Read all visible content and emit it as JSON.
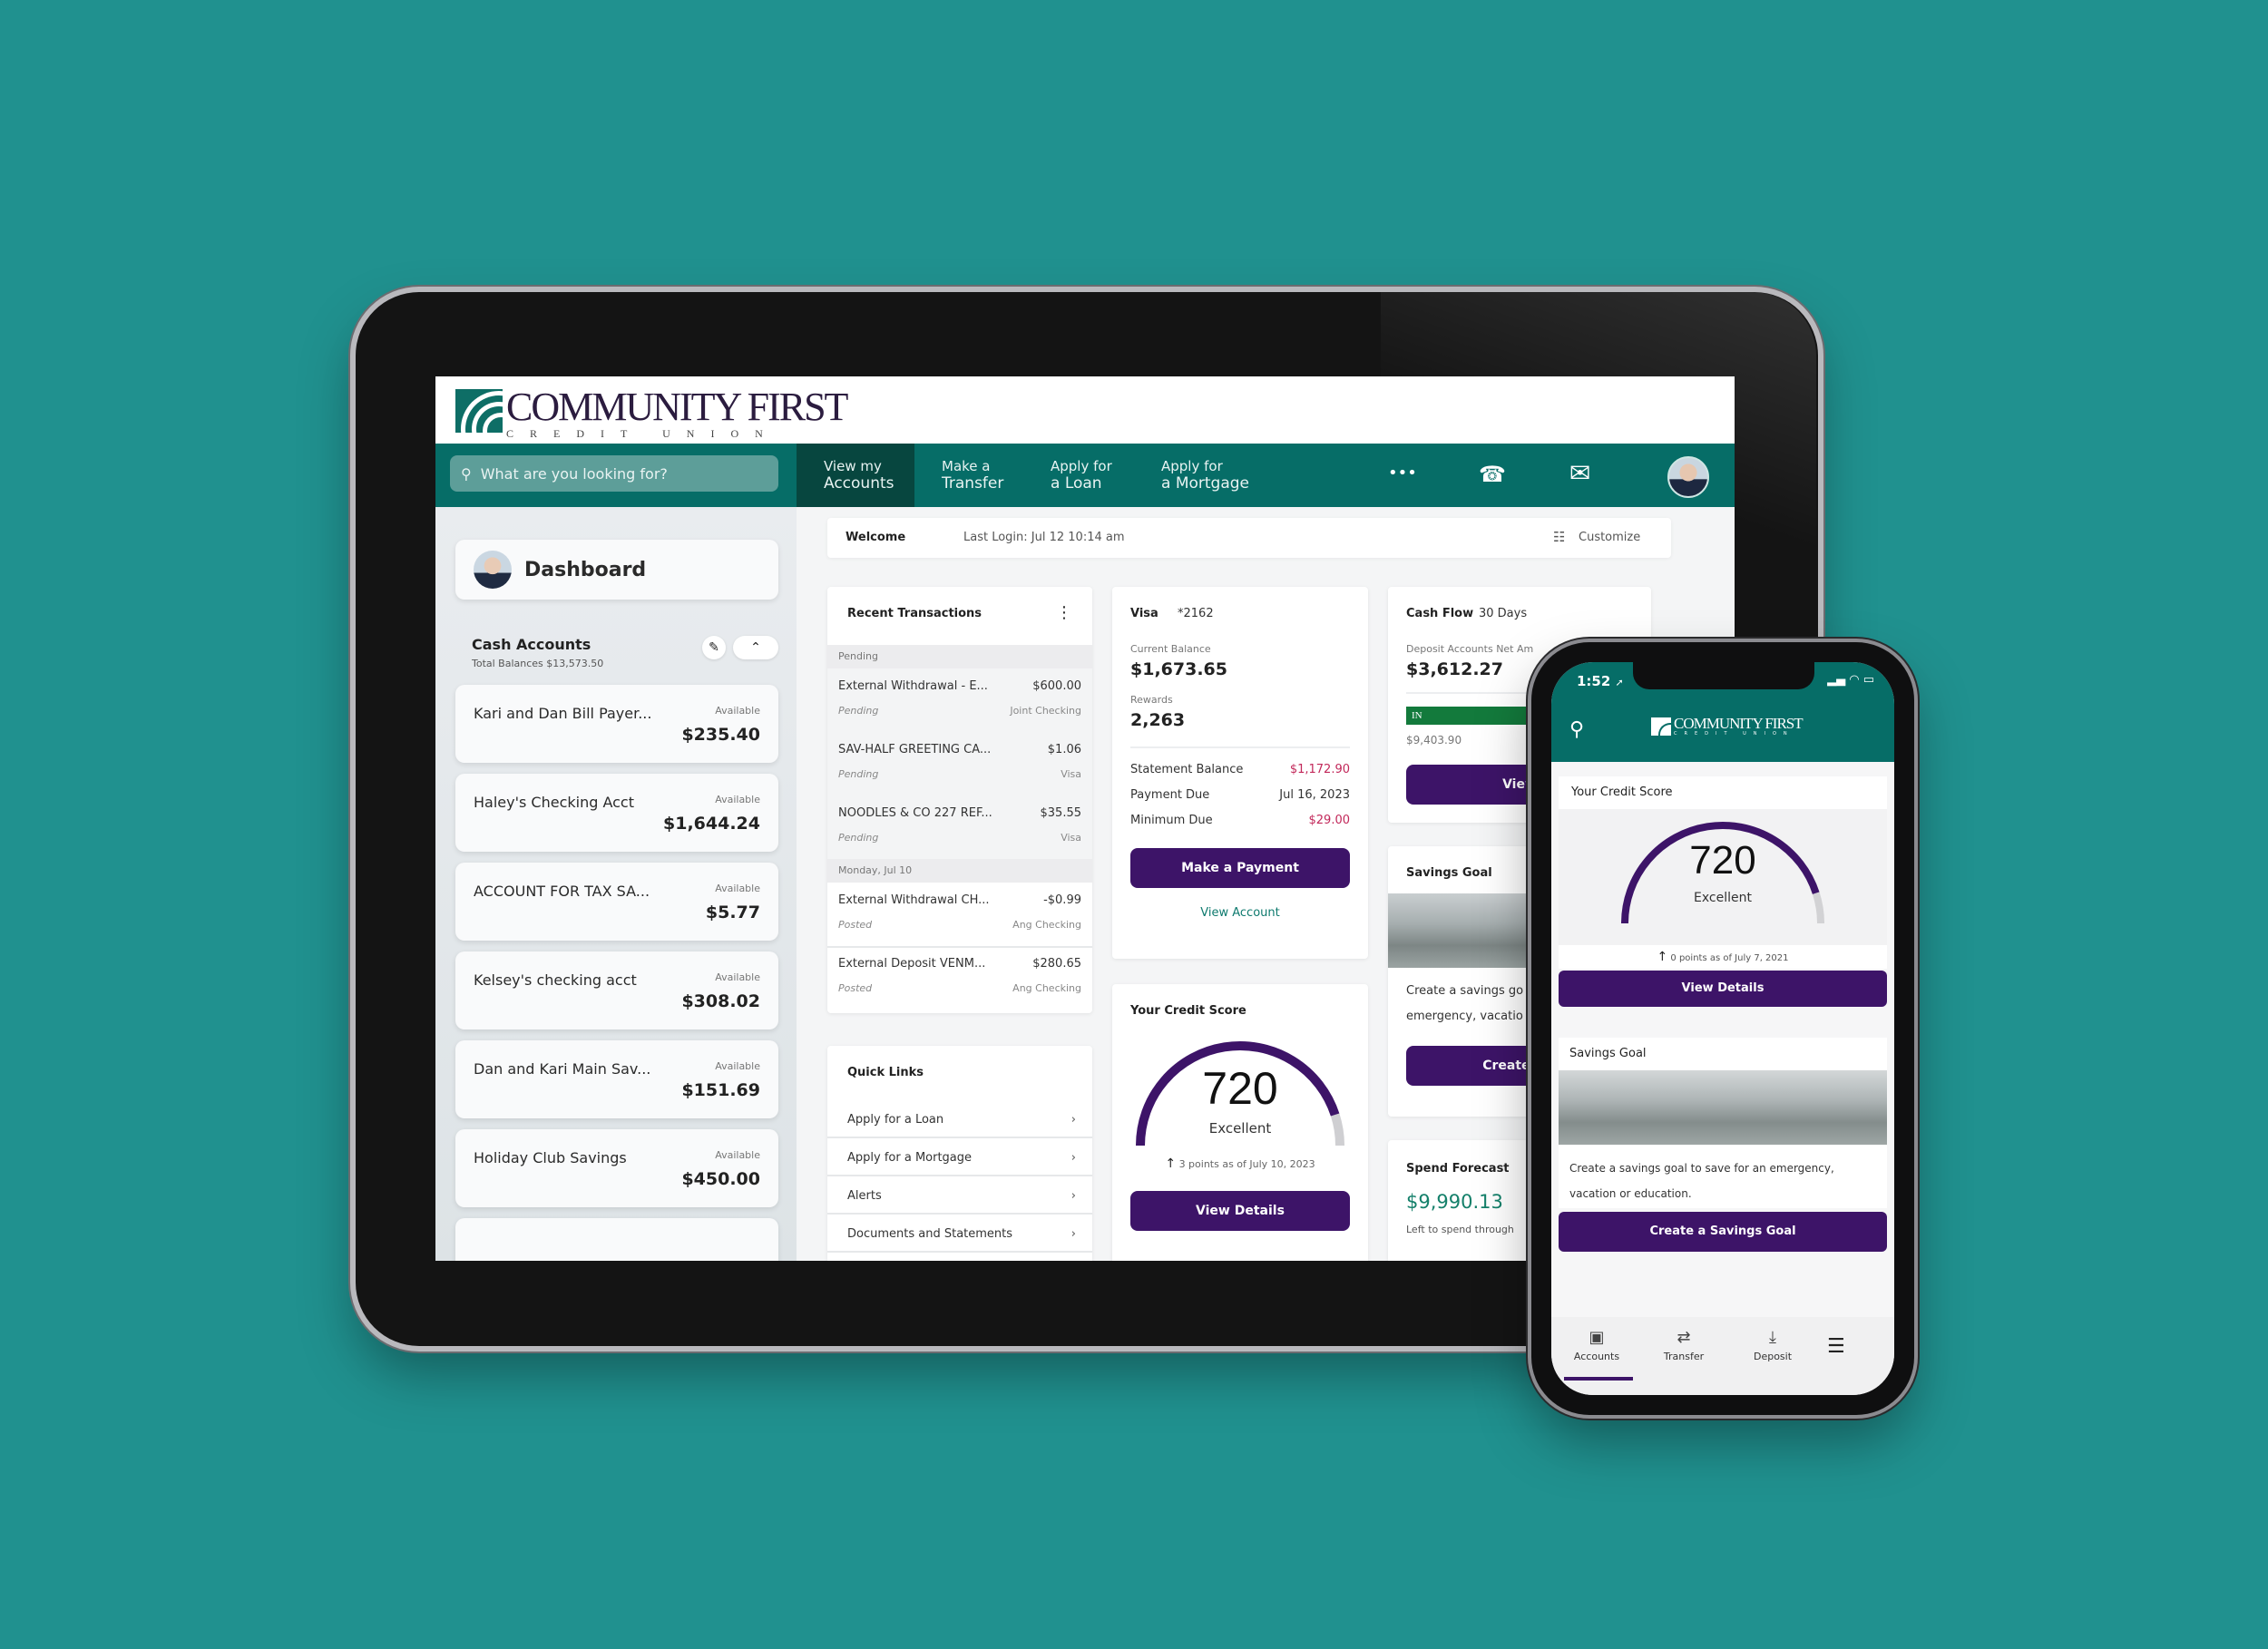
{
  "brand": {
    "name_main": "COMMUNITY FIRST",
    "name_sub": "CREDIT UNION",
    "primary_color": "#066d67",
    "accent_color": "#3d1468",
    "background_color": "#20918f"
  },
  "tablet": {
    "search": {
      "placeholder": "What are you looking for?",
      "icon": "search-icon"
    },
    "nav": [
      {
        "line1": "View my",
        "line2": "Accounts",
        "active": true
      },
      {
        "line1": "Make a",
        "line2": "Transfer",
        "active": false
      },
      {
        "line1": "Apply for",
        "line2": "a Loan",
        "active": false
      },
      {
        "line1": "Apply for",
        "line2": "a Mortgage",
        "active": false
      }
    ],
    "nav_icons": {
      "more": "•••",
      "phone": "☎",
      "mail": "✉"
    },
    "sidebar": {
      "dashboard_title": "Dashboard",
      "cash_accounts_title": "Cash Accounts",
      "cash_accounts_total": "Total Balances $13,573.50",
      "edit_icon": "✎",
      "collapse_icon": "⌃",
      "available_label": "Available",
      "accounts": [
        {
          "name": "Kari and Dan Bill Payer...",
          "balance": "$235.40"
        },
        {
          "name": "Haley's Checking Acct",
          "balance": "$1,644.24"
        },
        {
          "name": "ACCOUNT FOR TAX SA...",
          "balance": "$5.77"
        },
        {
          "name": "Kelsey's checking acct",
          "balance": "$308.02"
        },
        {
          "name": "Dan and Kari Main Sav...",
          "balance": "$151.69"
        },
        {
          "name": "Holiday Club Savings",
          "balance": "$450.00"
        }
      ]
    },
    "welcome": {
      "label": "Welcome",
      "last_login": "Last Login: Jul 12 10:14 am",
      "customize": "Customize",
      "customize_icon": "☷"
    },
    "transactions": {
      "title": "Recent Transactions",
      "menu_icon": "⋮",
      "groups": [
        {
          "label": "Pending",
          "items": [
            {
              "desc": "External Withdrawal - E...",
              "amount": "$600.00",
              "status": "Pending",
              "account": "Joint Checking",
              "tone": "neutral"
            },
            {
              "desc": "SAV-HALF GREETING CA...",
              "amount": "$1.06",
              "status": "Pending",
              "account": "Visa",
              "tone": "neutral"
            },
            {
              "desc": "NOODLES & CO 227 REF...",
              "amount": "$35.55",
              "status": "Pending",
              "account": "Visa",
              "tone": "neutral"
            }
          ]
        },
        {
          "label": "Monday, Jul 10",
          "items": [
            {
              "desc": "External Withdrawal CH...",
              "amount": "-$0.99",
              "status": "Posted",
              "account": "Ang Checking",
              "tone": "negative"
            },
            {
              "desc": "External Deposit VENM...",
              "amount": "$280.65",
              "status": "Posted",
              "account": "Ang Checking",
              "tone": "positive"
            }
          ]
        }
      ]
    },
    "quick_links": {
      "title": "Quick Links",
      "items": [
        "Apply for a Loan",
        "Apply for a Mortgage",
        "Alerts",
        "Documents and Statements"
      ]
    },
    "visa": {
      "title": "Visa",
      "number": "*2162",
      "current_balance_label": "Current Balance",
      "current_balance": "$1,673.65",
      "rewards_label": "Rewards",
      "rewards": "2,263",
      "rows": [
        {
          "label": "Statement Balance",
          "value": "$1,172.90",
          "tone": "negative"
        },
        {
          "label": "Payment Due",
          "value": "Jul 16, 2023",
          "tone": "neutral"
        },
        {
          "label": "Minimum Due",
          "value": "$29.00",
          "tone": "negative"
        }
      ],
      "pay_button": "Make a Payment",
      "view_account": "View Account"
    },
    "credit_score": {
      "title": "Your Credit Score",
      "score": "720",
      "rating": "Excellent",
      "fill_fraction": 0.9,
      "change": "3 points as of July 10, 2023",
      "button": "View Details"
    },
    "cash_flow": {
      "title": "Cash Flow",
      "period": "30 Days",
      "net_label": "Deposit Accounts Net Am",
      "net_value": "$3,612.27",
      "in_label": "IN",
      "in_value": "$9,403.90",
      "button": "View"
    },
    "savings_goal": {
      "title": "Savings Goal",
      "text_line1": "Create a savings go",
      "text_line2": "emergency, vacatio",
      "button": "Create a S"
    },
    "spend_forecast": {
      "title": "Spend Forecast",
      "value": "$9,990.13",
      "caption": "Left to spend through"
    }
  },
  "phone": {
    "time": "1:52",
    "location_icon": "➚",
    "status_icons": "▂▄ ◠ ▭",
    "credit_score": {
      "title": "Your Credit Score",
      "score": "720",
      "rating": "Excellent",
      "fill_fraction": 0.9,
      "change": "0 points as of July 7, 2021",
      "button": "View Details"
    },
    "savings_goal": {
      "title": "Savings Goal",
      "text": "Create a savings goal to save for an emergency, vacation or education.",
      "button": "Create a Savings Goal"
    },
    "tabs": [
      {
        "label": "Accounts",
        "icon": "▣",
        "active": true
      },
      {
        "label": "Transfer",
        "icon": "⇄",
        "active": false
      },
      {
        "label": "Deposit",
        "icon": "⤓",
        "active": false
      }
    ],
    "menu_icon": "☰"
  }
}
